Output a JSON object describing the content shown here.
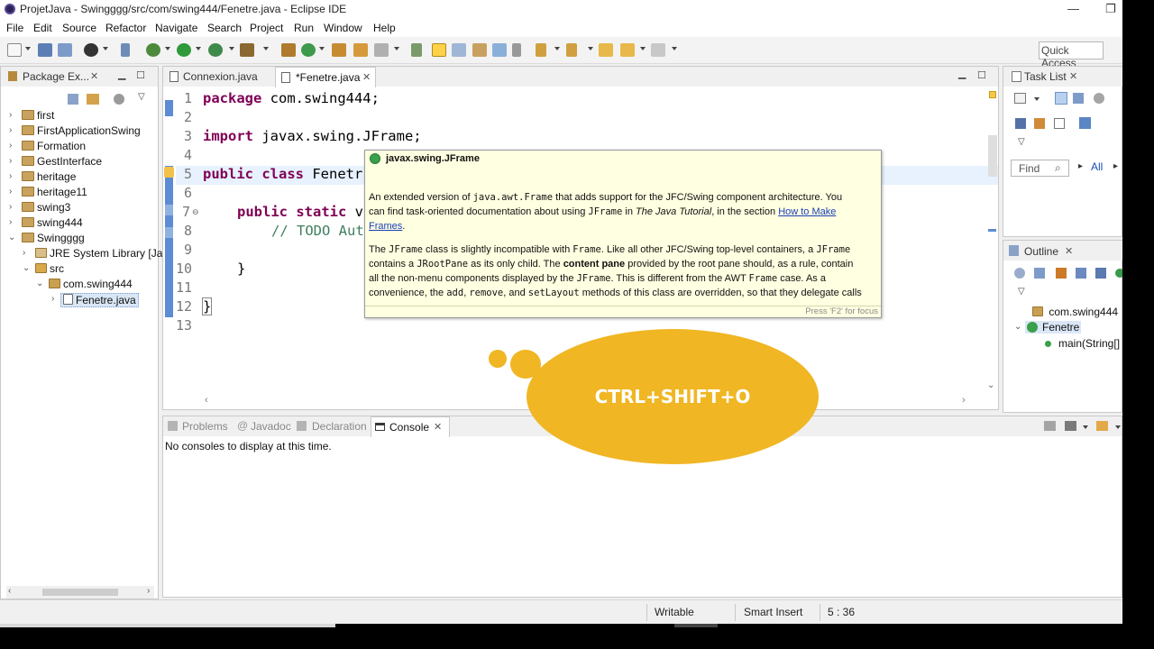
{
  "window": {
    "title": "ProjetJava - Swingggg/src/com/swing444/Fenetre.java - Eclipse IDE",
    "minimize": "—",
    "restore": "❐"
  },
  "menu": [
    "File",
    "Edit",
    "Source",
    "Refactor",
    "Navigate",
    "Search",
    "Project",
    "Run",
    "Window",
    "Help"
  ],
  "toolbar": {
    "quick_access": "Quick Access"
  },
  "package_explorer": {
    "tab_label": "Package Ex...",
    "projects": [
      "first",
      "FirstApplicationSwing",
      "Formation",
      "GestInterface",
      "heritage",
      "heritage11",
      "swing3",
      "swing444",
      "Swingggg"
    ],
    "jre_label": "JRE System Library [Jav",
    "src_label": "src",
    "package_label": "com.swing444",
    "file_label": "Fenetre.java"
  },
  "editor": {
    "tabs": [
      {
        "label": "Connexion.java",
        "active": false
      },
      {
        "label": "*Fenetre.java",
        "active": true
      }
    ],
    "line_numbers": [
      "1",
      "2",
      "3",
      "4",
      "5",
      "6",
      "7",
      "8",
      "9",
      "10",
      "11",
      "12",
      "13"
    ],
    "code": {
      "l1_kw": "package",
      "l1_rest": " com.swing444;",
      "l3_kw": "import",
      "l3_rest": " javax.swing.JFrame;",
      "l5_kw1": "public",
      "l5_kw2": "class",
      "l5_rest": " Fenetr",
      "l7_kw1": "public",
      "l7_kw2": "static",
      "l7_rest": " v",
      "l8_comment": "// TODO Aut",
      "l10": "}",
      "l12": "}"
    }
  },
  "tooltip": {
    "title": "javax.swing.JFrame",
    "p1_a": "An extended version of ",
    "p1_code1": "java.awt.Frame",
    "p1_b": " that adds support for the JFC/Swing component architecture. You",
    "p1_c": "can find task-oriented documentation about using ",
    "p1_code2": "JFrame",
    "p1_d": " in ",
    "p1_italic": "The Java Tutorial",
    "p1_e": ", in the section ",
    "p1_link": "How to Make",
    "p1_link2": "Frames",
    "p1_end": ".",
    "p2_l1_a": "The ",
    "p2_l1_code": "JFrame",
    "p2_l1_b": " class is slightly incompatible with ",
    "p2_l1_code2": "Frame",
    "p2_l1_c": ". Like all other JFC/Swing top-level containers, a ",
    "p2_l1_code3": "JFrame",
    "p2_l2_a": "contains a ",
    "p2_l2_code": "JRootPane",
    "p2_l2_b": " as its only child. The ",
    "p2_l2_bold": "content pane",
    "p2_l2_c": " provided by the root pane should, as a rule, contain",
    "p2_l3_a": "all the non-menu components displayed by the ",
    "p2_l3_code": "JFrame",
    "p2_l3_b": ". This is different from the AWT ",
    "p2_l3_code2": "Frame",
    "p2_l3_c": " case. As a",
    "p2_l4_a": "convenience, the ",
    "p2_l4_code1": "add",
    "p2_l4_b": ", ",
    "p2_l4_code2": "remove",
    "p2_l4_c": ", and ",
    "p2_l4_code3": "setLayout",
    "p2_l4_d": " methods of this class are overridden, so that they delegate calls",
    "focus_hint": "Press 'F2' for focus"
  },
  "task_list": {
    "tab_label": "Task List",
    "find_placeholder": "Find",
    "all_label": "All"
  },
  "outline": {
    "tab_label": "Outline",
    "package": "com.swing444",
    "class": "Fenetre",
    "method": "main(String[]"
  },
  "bottom_panel": {
    "tabs": [
      "Problems",
      "Javadoc",
      "Declaration",
      "Console"
    ],
    "active_tab": "Console",
    "message": "No consoles to display at this time."
  },
  "status_bar": {
    "writable": "Writable",
    "insert_mode": "Smart Insert",
    "position": "5 : 36"
  },
  "overlay": {
    "shortcut": "CTRL+SHIFT+O"
  },
  "colors": {
    "keyword": "#7f0055",
    "comment": "#3f7f5f",
    "bubble": "#f0b623",
    "tooltip_bg": "#ffffe1"
  }
}
